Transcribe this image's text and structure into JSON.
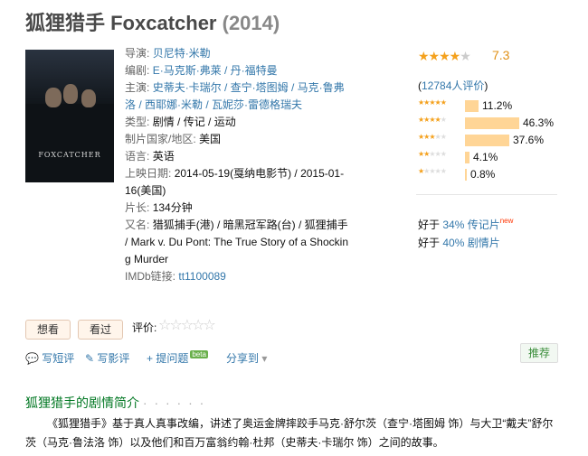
{
  "title": {
    "name": "狐狸猎手 Foxcatcher",
    "year": "(2014)"
  },
  "poster": {
    "text": "FOXCATCHER"
  },
  "info": {
    "director_label": "导演:",
    "director": "贝尼特·米勒",
    "writer_label": "编剧:",
    "writer": "E·马克斯·弗莱 / 丹·福特曼",
    "cast_label": "主演:",
    "cast_line1": "史蒂夫·卡瑞尔 / 查宁·塔图姆 / 马克·鲁弗",
    "cast_line2": "洛 / 西耶娜·米勒 / 瓦妮莎·雷德格瑞夫",
    "genre_label": "类型:",
    "genre": "剧情 / 传记 / 运动",
    "country_label": "制片国家/地区:",
    "country": "美国",
    "language_label": "语言:",
    "language": "英语",
    "release_label": "上映日期:",
    "release_line1": "2014-05-19(戛纳电影节) / 2015-01-",
    "release_line2": "16(美国)",
    "runtime_label": "片长:",
    "runtime": "134分钟",
    "aka_label": "又名:",
    "aka_line1": "猎狐捕手(港) / 暗黑冠军路(台) / 狐狸捕手",
    "aka_line2": "/ Mark v. Du Pont: The True Story of a Shockin",
    "aka_line3": "g Murder",
    "imdb_label": "IMDb链接:",
    "imdb": "tt1100089"
  },
  "rating": {
    "score": "7.3",
    "stars_value": 3.5,
    "votes": "12784人评价",
    "votes_open": "(",
    "votes_close": ")",
    "distribution": [
      {
        "stars": 5,
        "percent": 11.2,
        "label": "11.2%"
      },
      {
        "stars": 4,
        "percent": 46.3,
        "label": "46.3%"
      },
      {
        "stars": 3,
        "percent": 37.6,
        "label": "37.6%"
      },
      {
        "stars": 2,
        "percent": 4.1,
        "label": "4.1%"
      },
      {
        "stars": 1,
        "percent": 0.8,
        "label": "0.8%"
      }
    ]
  },
  "better_than": {
    "prefix": "好于",
    "line1_link": "34% 传记片",
    "line1_badge": "new",
    "line2_link": "40% 剧情片"
  },
  "buttons": {
    "want": "想看",
    "seen": "看过",
    "rate_label": "评价:"
  },
  "actions": {
    "short_review": "写短评",
    "review": "写影评",
    "ask": "+ 提问题",
    "ask_badge": "beta",
    "share": "分享到",
    "recommend": "推荐"
  },
  "synopsis": {
    "heading": "狐狸猎手的剧情简介",
    "dots": "· · · · · ·",
    "text": "《狐狸猎手》基于真人真事改编，讲述了奥运金牌摔跤手马克·舒尔茨（查宁·塔图姆 饰）与大卫“戴夫”舒尔茨（马克·鲁法洛 饰）以及他们和百万富翁约翰·杜邦（史蒂夫·卡瑞尔 饰）之间的故事。"
  },
  "colors": {
    "link": "#3377aa",
    "star": "#f4a11d",
    "bar": "#ffd596",
    "heading_green": "#007722"
  }
}
